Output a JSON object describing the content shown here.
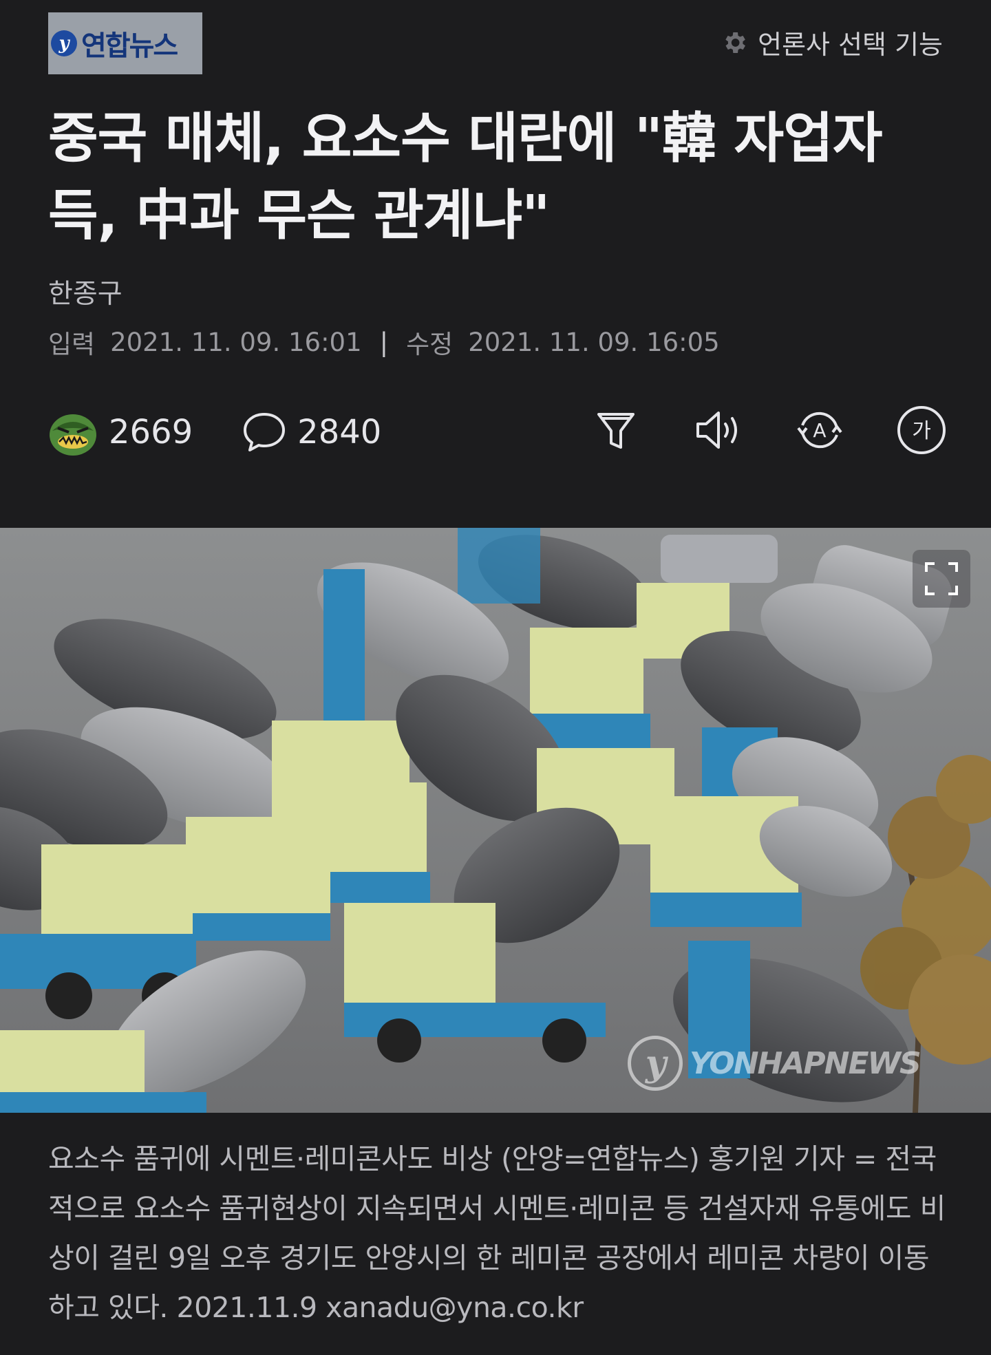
{
  "header": {
    "logo_text": "연합뉴스",
    "press_select_label": "언론사 선택 기능"
  },
  "article": {
    "title": "중국 매체, 요소수 대란에 \"韓 자업자득, 中과 무슨 관계냐\"",
    "author": "한종구",
    "published_label": "입력",
    "published": "2021. 11. 09. 16:01",
    "modified_label": "수정",
    "modified": "2021. 11. 09. 16:05"
  },
  "stats": {
    "reactions": "2669",
    "comments": "2840"
  },
  "tools": [
    "filter-icon",
    "speaker-icon",
    "translate-icon",
    "font-size-icon"
  ],
  "font_tool_label": "가",
  "translate_tool_label": "A",
  "photo": {
    "watermark": "YONHAPNEWS",
    "caption": "요소수 품귀에 시멘트·레미콘사도 비상 (안양=연합뉴스) 홍기원 기자 = 전국적으로 요소수 품귀현상이 지속되면서 시멘트·레미콘 등 건설자재 유통에도 비상이 걸린 9일 오후 경기도 안양시의 한 레미콘 공장에서 레미콘 차량이 이동하고 있다. 2021.11.9 xanadu@yna.co.kr"
  },
  "colors": {
    "background": "#1c1c1e",
    "truck_blue": "#2f86b8",
    "cab_yellow": "#d9dfa0"
  }
}
